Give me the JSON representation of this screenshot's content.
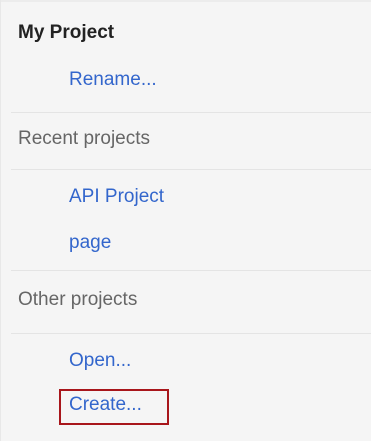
{
  "project_menu": {
    "current_project": "My Project",
    "rename_label": "Rename...",
    "recent_heading": "Recent projects",
    "recent_items": [
      {
        "label": "API Project"
      },
      {
        "label": "page"
      }
    ],
    "other_heading": "Other projects",
    "open_label": "Open...",
    "create_label": "Create..."
  },
  "colors": {
    "link": "#3366cc",
    "highlight_border": "#a8161b"
  }
}
